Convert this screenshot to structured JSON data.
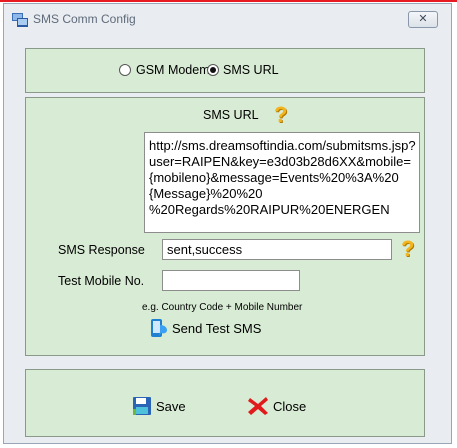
{
  "window": {
    "title": "SMS Comm Config",
    "close_glyph": "✕"
  },
  "mode": {
    "options": [
      {
        "label": "GSM Modem",
        "selected": false
      },
      {
        "label": "SMS URL",
        "selected": true
      }
    ]
  },
  "sms_url": {
    "heading": "SMS URL",
    "help_glyph": "?",
    "value": "http://sms.dreamsoftindia.com/submitsms.jsp?\nuser=RAIPEN&key=e3d03b28d6XX&mobile=\n{mobileno}&message=Events%20%3A%20\n{Message}%20%20\n%20Regards%20RAIPUR%20ENERGEN"
  },
  "sms_response": {
    "label": "SMS Response",
    "value": "sent,success",
    "help_glyph": "?"
  },
  "test_mobile": {
    "label": "Test Mobile No.",
    "value": "",
    "hint": "e.g. Country Code + Mobile Number"
  },
  "send_test": {
    "label": "Send Test SMS",
    "icon": "phone-icon"
  },
  "actions": {
    "save_label": "Save",
    "close_label": "Close",
    "save_icon": "save-icon",
    "close_icon": "red-x-icon"
  },
  "colors": {
    "group_bg": "#d8ecd5",
    "accent_red": "#e81b23",
    "help_yellow": "#f2b51f"
  }
}
